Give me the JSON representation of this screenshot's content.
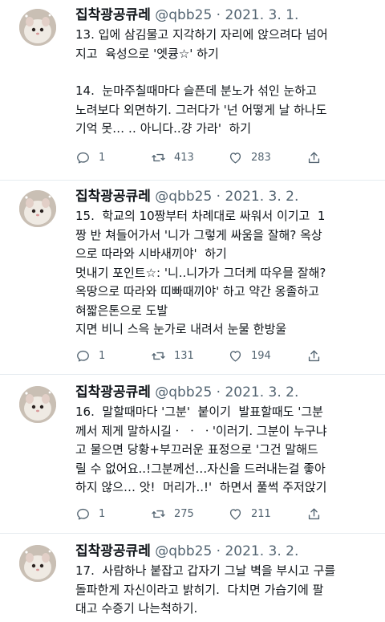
{
  "account": {
    "name": "집착광공큐레",
    "handle": "@qbb25"
  },
  "tweets": [
    {
      "date": "2021. 3. 1.",
      "paragraphs": [
        "13. 입에 삼김물고 지각하기 자리에 앉으려다 넘어\n지고  육성으로 '엣큥☆' 하기",
        "14.  눈마주칠때마다 슬픈데 분노가 섞인 눈하고\n노려보다 외면하기. 그러다가 '넌 어떻게 날 하나도\n기억 못… ‥ 아니다..걍 가라'  하기"
      ],
      "replies": "1",
      "retweets": "413",
      "likes": "283"
    },
    {
      "date": "2021. 3. 2.",
      "paragraphs": [
        "15.  학교의 10짱부터 차례대로 싸워서 이기고  1\n짱 반 쳐들어가서 '니가 그렇게 싸움을 잘해? 옥상\n으로 따라와 시바새끼야'  하기\n멋내기 포인트☆: '니..니가가 그더케 따우믈 잘해?\n옥땅으로 따라와 띠빠때끼야' 하고 약간 옹졸하고\n혀짧은톤으로 도발\n지면 비니 스윽 눈가로 내려서 눈물 한방울"
      ],
      "replies": "1",
      "retweets": "131",
      "likes": "194"
    },
    {
      "date": "2021. 3. 2.",
      "paragraphs": [
        "16.  말할때마다 '그분'  붙이기  발표할때도 '그분\n께서 제게 말하시길ㆍ ㆍ ㆍ'이러기. 그분이 누구냐\n고 물으면 당황+부끄러운 표정으로 '그건 말해드\n릴 수 없어요..!그분께선…자신을 드러내는걸 좋아\n하지 않으… 앗!  머리가..!'  하면서 풀썩 주저앉기"
      ],
      "replies": "1",
      "retweets": "275",
      "likes": "211"
    },
    {
      "date": "2021. 3. 2.",
      "paragraphs": [
        "17.  사람하나 붙잡고 갑자기 그날 벽을 부시고 구를\n돌파한게 자신이라고 밝히기.  다치면 가습기에 팔\n대고 수증기 나는척하기."
      ]
    }
  ],
  "icons": {
    "reply": "reply-icon",
    "retweet": "retweet-icon",
    "like": "heart-icon",
    "share": "share-icon"
  },
  "colors": {
    "text": "#0f1419",
    "muted": "#536471",
    "divider": "#e6ecf0"
  }
}
